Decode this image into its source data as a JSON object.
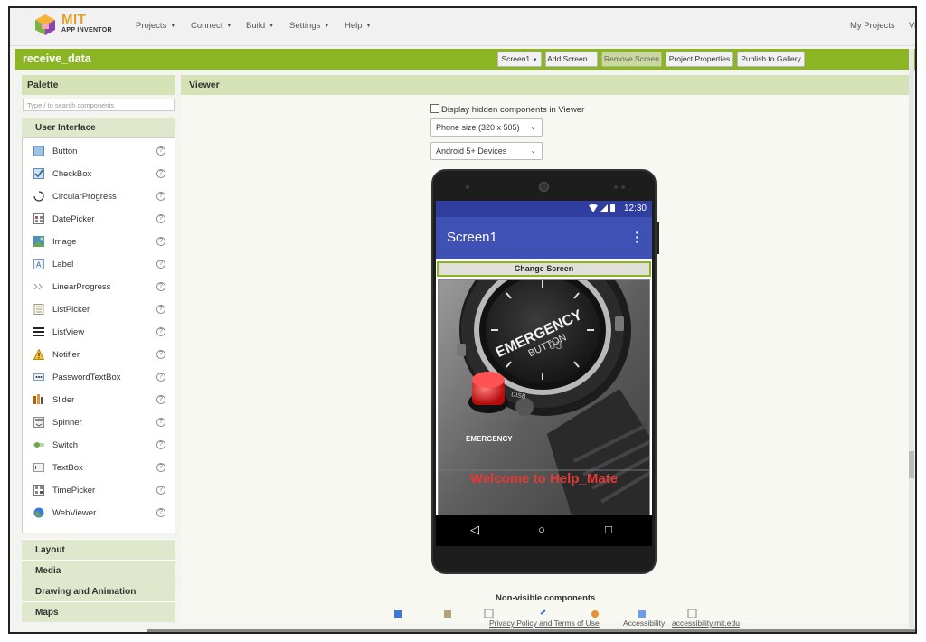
{
  "nav": {
    "logo_mit": "MIT",
    "logo_sub": "APP INVENTOR",
    "menus": [
      "Projects",
      "Connect",
      "Build",
      "Settings",
      "Help"
    ],
    "my_projects": "My Projects",
    "view_trash": "Vi"
  },
  "project": {
    "name": "receive_data",
    "screen_select": "Screen1",
    "add_screen": "Add Screen ...",
    "remove_screen": "Remove Screen",
    "properties": "Project Properties",
    "publish": "Publish to Gallery"
  },
  "palette": {
    "title": "Palette",
    "search_placeholder": "Type / to search components",
    "category": "User Interface",
    "items": [
      {
        "label": "Button",
        "icon": "button-icon"
      },
      {
        "label": "CheckBox",
        "icon": "checkbox-icon"
      },
      {
        "label": "CircularProgress",
        "icon": "circular-progress-icon"
      },
      {
        "label": "DatePicker",
        "icon": "datepicker-icon"
      },
      {
        "label": "Image",
        "icon": "image-icon"
      },
      {
        "label": "Label",
        "icon": "label-icon"
      },
      {
        "label": "LinearProgress",
        "icon": "linear-progress-icon"
      },
      {
        "label": "ListPicker",
        "icon": "listpicker-icon"
      },
      {
        "label": "ListView",
        "icon": "listview-icon"
      },
      {
        "label": "Notifier",
        "icon": "notifier-icon"
      },
      {
        "label": "PasswordTextBox",
        "icon": "password-textbox-icon"
      },
      {
        "label": "Slider",
        "icon": "slider-icon"
      },
      {
        "label": "Spinner",
        "icon": "spinner-icon"
      },
      {
        "label": "Switch",
        "icon": "switch-icon"
      },
      {
        "label": "TextBox",
        "icon": "textbox-icon"
      },
      {
        "label": "TimePicker",
        "icon": "timepicker-icon"
      },
      {
        "label": "WebViewer",
        "icon": "webviewer-icon"
      }
    ],
    "help_glyph": "?",
    "subcategories": [
      "Layout",
      "Media",
      "Drawing and Animation",
      "Maps"
    ]
  },
  "viewer": {
    "title": "Viewer",
    "hidden_components": "Display hidden components in Viewer",
    "size_select": "Phone size (320 x 505)",
    "device_select": "Android 5+ Devices",
    "non_visible": "Non-visible components"
  },
  "phone": {
    "time": "12:30",
    "screen_title": "Screen1",
    "button_text": "Change Screen",
    "watch_text_1": "EMERGENCY",
    "watch_text_2": "BUTTON",
    "watch_number": "33",
    "watch_side_label": "EMERGENCY",
    "watch_disb": "DISB",
    "welcome": "Welcome to Help_Mate",
    "colors": {
      "status": "#303f9f",
      "appbar": "#3f51b5",
      "welcome": "#e53935"
    }
  },
  "footer": {
    "privacy": "Privacy Policy and Terms of Use",
    "accessibility_label": "Accessibility:",
    "accessibility_link": "accessibility.mit.edu"
  },
  "theme": {
    "accent": "#8bb523",
    "panel_head": "#d5e2b6"
  }
}
